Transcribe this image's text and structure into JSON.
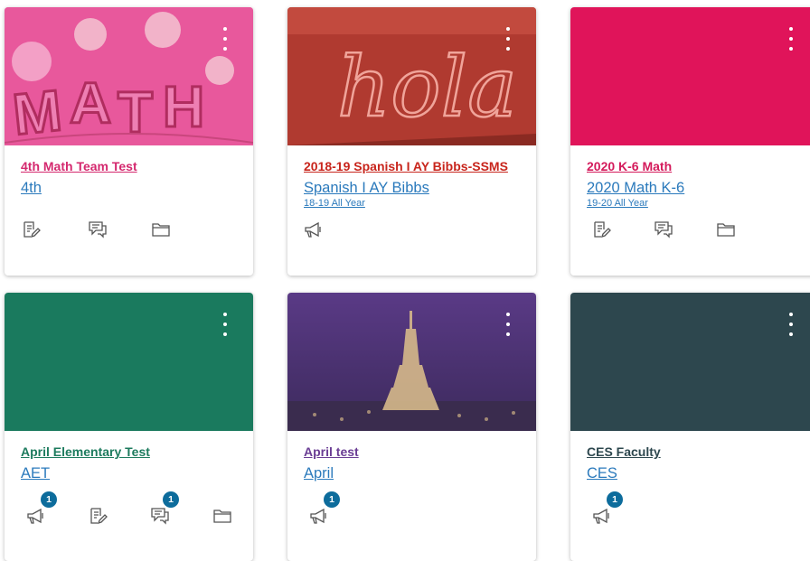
{
  "cards": [
    {
      "title": "4th Math Team Test",
      "code": "4th",
      "term": "",
      "color": "#e4457f",
      "icons": [
        "assignments",
        "discussions",
        "files"
      ],
      "badges": {}
    },
    {
      "title": "2018-19 Spanish I AY Bibbs-SSMS",
      "code": "Spanish I AY Bibbs",
      "term": "18-19 All Year",
      "color": "#c8251c",
      "icons": [
        "announcements"
      ],
      "badges": {}
    },
    {
      "title": "2020 K-6 Math",
      "code": "2020 Math K-6",
      "term": "19-20 All Year",
      "color": "#d41a5b",
      "icons": [
        "assignments",
        "discussions",
        "files"
      ],
      "badges": {}
    },
    {
      "title": "April Elementary Test",
      "code": "AET",
      "term": "",
      "color": "#1d7b5e",
      "icons": [
        "announcements",
        "assignments",
        "discussions",
        "files"
      ],
      "badges": {
        "announcements": "1",
        "discussions": "1"
      }
    },
    {
      "title": "April test",
      "code": "April",
      "term": "",
      "color": "#6a3d94",
      "icons": [
        "announcements"
      ],
      "badges": {
        "announcements": "1"
      }
    },
    {
      "title": "CES Faculty",
      "code": "CES",
      "term": "",
      "color": "#2d474e",
      "icons": [
        "announcements"
      ],
      "badges": {
        "announcements": "1"
      }
    }
  ]
}
